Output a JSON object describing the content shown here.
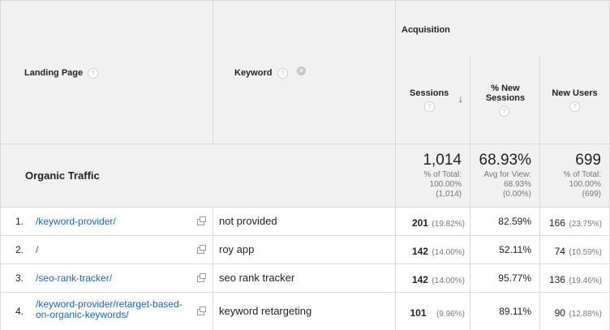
{
  "header": {
    "landing_page": "Landing Page",
    "keyword": "Keyword",
    "acquisition": "Acquisition",
    "sessions": "Sessions",
    "new_sessions_line1": "% New",
    "new_sessions_line2": "Sessions",
    "new_users": "New Users",
    "help_glyph": "?",
    "remove_glyph": "×",
    "sort_glyph": "↓"
  },
  "summary": {
    "label": "Organic Traffic",
    "sessions": {
      "value": "1,014",
      "line1": "% of Total:",
      "line2": "100.00%",
      "line3": "(1,014)"
    },
    "new_sessions": {
      "value": "68.93%",
      "line1": "Avg for View:",
      "line2": "68.93%",
      "line3": "(0.00%)"
    },
    "new_users": {
      "value": "699",
      "line1": "% of Total:",
      "line2": "100.00%",
      "line3": "(699)"
    }
  },
  "rows": [
    {
      "num": "1.",
      "page": "/keyword-provider/",
      "keyword": "not provided",
      "sessions": "201",
      "sessions_pct": "(19.82%)",
      "new_sessions": "82.59%",
      "new_users": "166",
      "new_users_pct": "(23.75%)"
    },
    {
      "num": "2.",
      "page": "/",
      "keyword": "roy app",
      "sessions": "142",
      "sessions_pct": "(14.00%)",
      "new_sessions": "52.11%",
      "new_users": "74",
      "new_users_pct": "(10.59%)"
    },
    {
      "num": "3.",
      "page": "/seo-rank-tracker/",
      "keyword": "seo rank tracker",
      "sessions": "142",
      "sessions_pct": "(14.00%)",
      "new_sessions": "95.77%",
      "new_users": "136",
      "new_users_pct": "(19.46%)"
    },
    {
      "num": "4.",
      "page": "/keyword-provider/retarget-based-",
      "page_line2": "on-organic-keywords/",
      "keyword": "keyword retargeting",
      "sessions": "101",
      "sessions_pct": "(9.96%)",
      "new_sessions": "89.11%",
      "new_users": "90",
      "new_users_pct": "(12.88%)"
    }
  ],
  "colors": {
    "link": "#1a65c0",
    "header_bg": "#f1f1f1",
    "border": "#d8d8d8"
  }
}
